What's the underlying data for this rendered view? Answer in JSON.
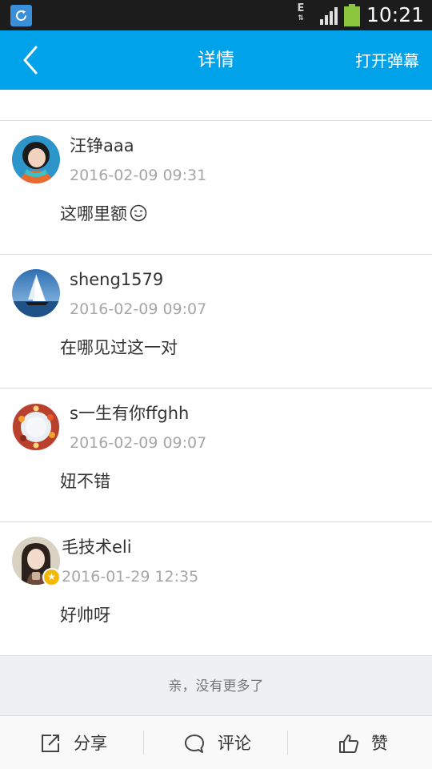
{
  "status_bar": {
    "network_type": "E",
    "time": "10:21",
    "app_icon": "refresh-app-icon",
    "battery_color": "#8cc63f"
  },
  "header": {
    "title": "详情",
    "back_icon": "chevron-left-icon",
    "danmaku_label": "打开弹幕",
    "background": "#00a2ea"
  },
  "comments": [
    {
      "username": "汪铮aaa",
      "time": "2016-02-09 09:31",
      "text": "这哪里额",
      "emoji": "smile-emoji-icon",
      "avatar": "girl-photo-avatar"
    },
    {
      "username": "sheng1579",
      "time": "2016-02-09 09:07",
      "text": "在哪见过这一对",
      "avatar": "sailboat-avatar"
    },
    {
      "username": "s一生有你ffghh",
      "time": "2016-02-09 09:07",
      "text": "妞不错",
      "avatar": "flower-wreath-avatar"
    },
    {
      "username": "毛技术eli",
      "time": "2016-01-29 12:35",
      "text": "好帅呀",
      "avatar": "woman-photo-avatar",
      "vip_badge": "star-badge-icon"
    }
  ],
  "list_footer": {
    "text": "亲，没有更多了"
  },
  "toolbar": {
    "share_label": "分享",
    "comment_label": "评论",
    "like_label": "赞",
    "share_icon": "share-icon",
    "comment_icon": "comment-bubble-icon",
    "like_icon": "thumbs-up-icon"
  }
}
